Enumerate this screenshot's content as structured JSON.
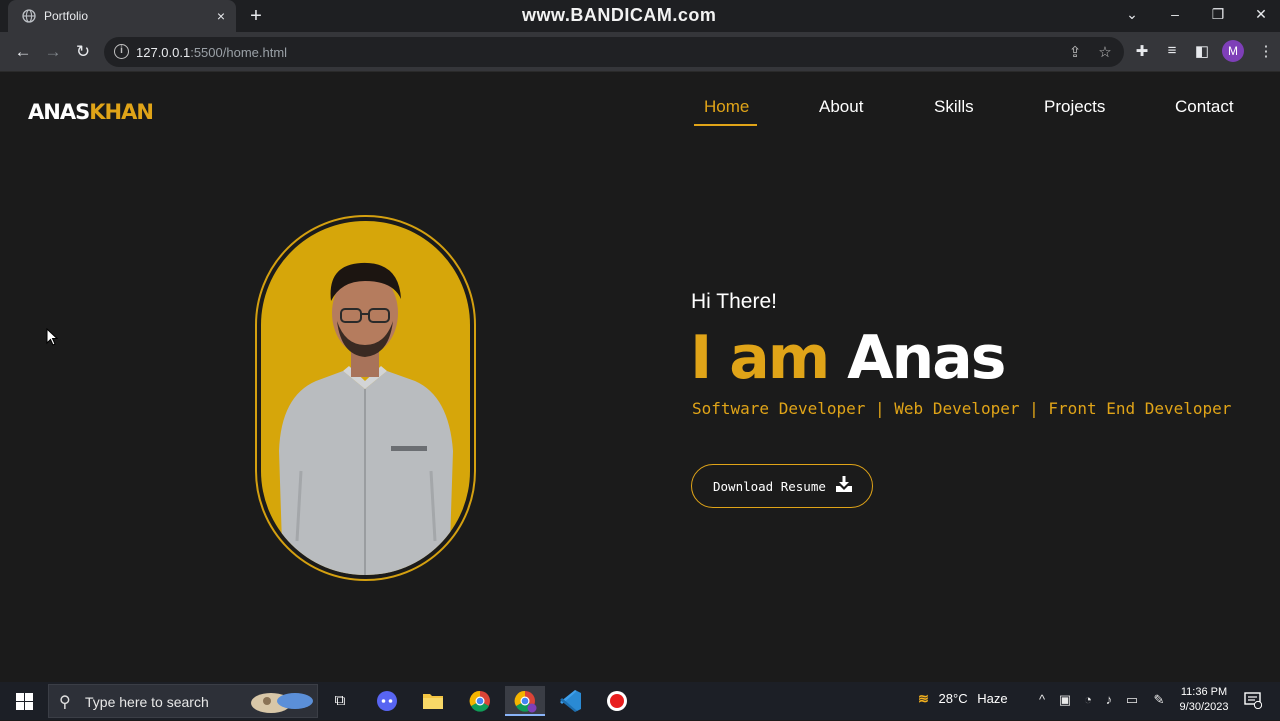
{
  "browser": {
    "tab_title": "Portfolio",
    "tab_close": "×",
    "new_tab": "+",
    "watermark": "www.BANDICAM.com",
    "url_host": "127.0.0.1",
    "url_path": ":5500/home.html",
    "profile_initial": "M"
  },
  "site": {
    "logo_part1": "ANAS",
    "logo_part2": "KHAN",
    "nav": [
      "Home",
      "About",
      "Skills",
      "Projects",
      "Contact"
    ],
    "active_nav": "Home",
    "greeting": "Hi There!",
    "headline_part1": "I am",
    "headline_part2": "Anas",
    "roles": "Software Developer | Web Developer | Front End Developer",
    "download_label": "Download Resume"
  },
  "taskbar": {
    "search_placeholder": "Type here to search",
    "weather_temp": "28°C",
    "weather_desc": "Haze",
    "time": "11:36 PM",
    "date": "9/30/2023"
  },
  "colors": {
    "accent": "#e0a418",
    "page_bg": "#1b1b1b",
    "photo_bg": "#d6a60a"
  }
}
